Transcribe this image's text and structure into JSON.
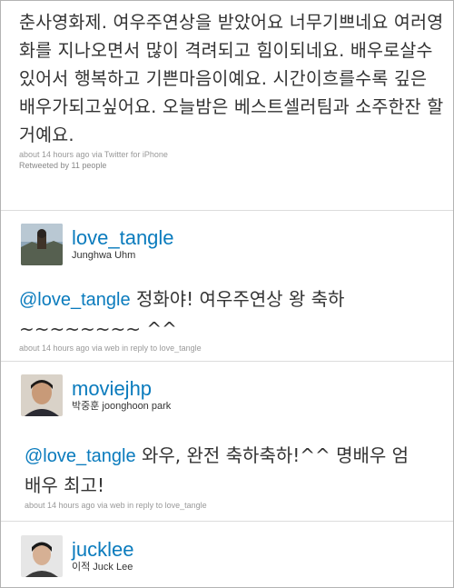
{
  "first_tweet": {
    "text": "춘사영화제. 여우주연상을 받았어요 너무기쁘네요 여러영화를 지나오면서 많이 격려되고 힘이되네요. 배우로살수있어서 행복하고 기쁜마음이예요. 시간이흐를수록 깊은 배우가되고싶어요. 오늘밤은 베스트셀러팀과 소주한잔 할거예요.",
    "meta": "about 14 hours ago via Twitter for iPhone",
    "retweeted": "Retweeted by 11 people"
  },
  "users": [
    {
      "screen_name": "love_tangle",
      "real_name": "Junghwa Uhm"
    },
    {
      "screen_name": "moviejhp",
      "real_name": "박중훈 joonghoon park"
    },
    {
      "screen_name": "jucklee",
      "real_name": "이적 Juck Lee"
    }
  ],
  "replies": [
    {
      "mention": "@love_tangle",
      "text": " 정화야! 여우주연상 왕 축하 ~~~~~~~~ ^^",
      "meta": "about 14 hours ago via web in reply to love_tangle"
    },
    {
      "mention": "@love_tangle",
      "text": " 와우, 완전 축하축하!^^ 명배우 엄배우 최고!",
      "meta": "about 14 hours ago via web in reply to love_tangle"
    }
  ]
}
